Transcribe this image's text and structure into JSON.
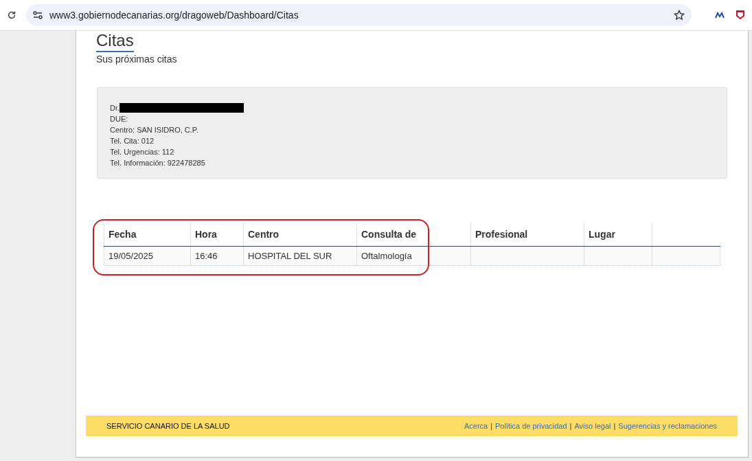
{
  "browser": {
    "url": "www3.gobiernodecanarias.org/dragoweb/Dashboard/Citas"
  },
  "page": {
    "title": "Citas",
    "subtitle": "Sus próximas citas"
  },
  "info": {
    "lines": [
      {
        "kind": "redacted",
        "label": "Dr."
      },
      {
        "kind": "text",
        "label": "DUE:"
      },
      {
        "kind": "text",
        "label": "Centro: SAN ISIDRO, C.P."
      },
      {
        "kind": "text",
        "label": "Tel. Cita: 012"
      },
      {
        "kind": "text",
        "label": "Tel. Urgencias: 112"
      },
      {
        "kind": "text",
        "label": "Tel. Información: 922478285"
      }
    ]
  },
  "table": {
    "columns": [
      "Fecha",
      "Hora",
      "Centro",
      "Consulta de",
      "Profesional",
      "Lugar"
    ],
    "rows": [
      [
        "19/05/2025",
        "16:46",
        "HOSPITAL DEL SUR",
        "Oftalmología",
        "",
        ""
      ]
    ]
  },
  "footer": {
    "name": "SERVICIO CANARIO DE LA SALUD",
    "separator": "|",
    "links": [
      "Acerca",
      "Política de privacidad",
      "Aviso legal",
      "Sugerencias y reclamaciones"
    ]
  }
}
